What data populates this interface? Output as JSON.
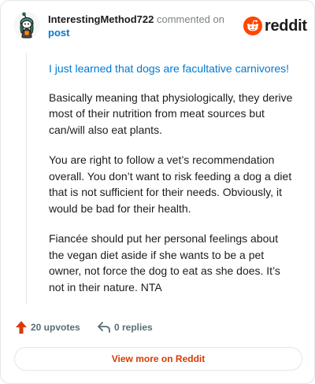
{
  "comment": {
    "username": "InterestingMethod722",
    "action_text": "commented on",
    "post_link": "post",
    "brand": "reddit",
    "paragraphs": {
      "quote": "I just learned that dogs are facultative carnivores!",
      "p1": "Basically meaning that physiologically, they derive most of their nutrition from meat sources but can/will also eat plants.",
      "p2": "You are right to follow a vet’s recommendation overall. You don’t want to risk feeding a dog a diet that is not sufficient for their needs. Obviously, it would be bad for their health.",
      "p3": "Fiancée should put her personal feelings about the vegan diet aside if she wants to be a pet owner, not force the dog to eat as she does. It’s not in their nature. NTA"
    },
    "upvotes": "20 upvotes",
    "replies": "0 replies",
    "view_more": "View more on Reddit"
  },
  "colors": {
    "brand_orange": "#ff4500",
    "link_blue": "#0079d3",
    "upvote_orange": "#d93a00",
    "meta_gray": "#576f76"
  },
  "icons": {
    "avatar": "snoo-avatar-icon",
    "brand": "reddit-logo-icon",
    "upvote": "upvote-arrow-icon",
    "reply": "reply-arrow-icon"
  }
}
